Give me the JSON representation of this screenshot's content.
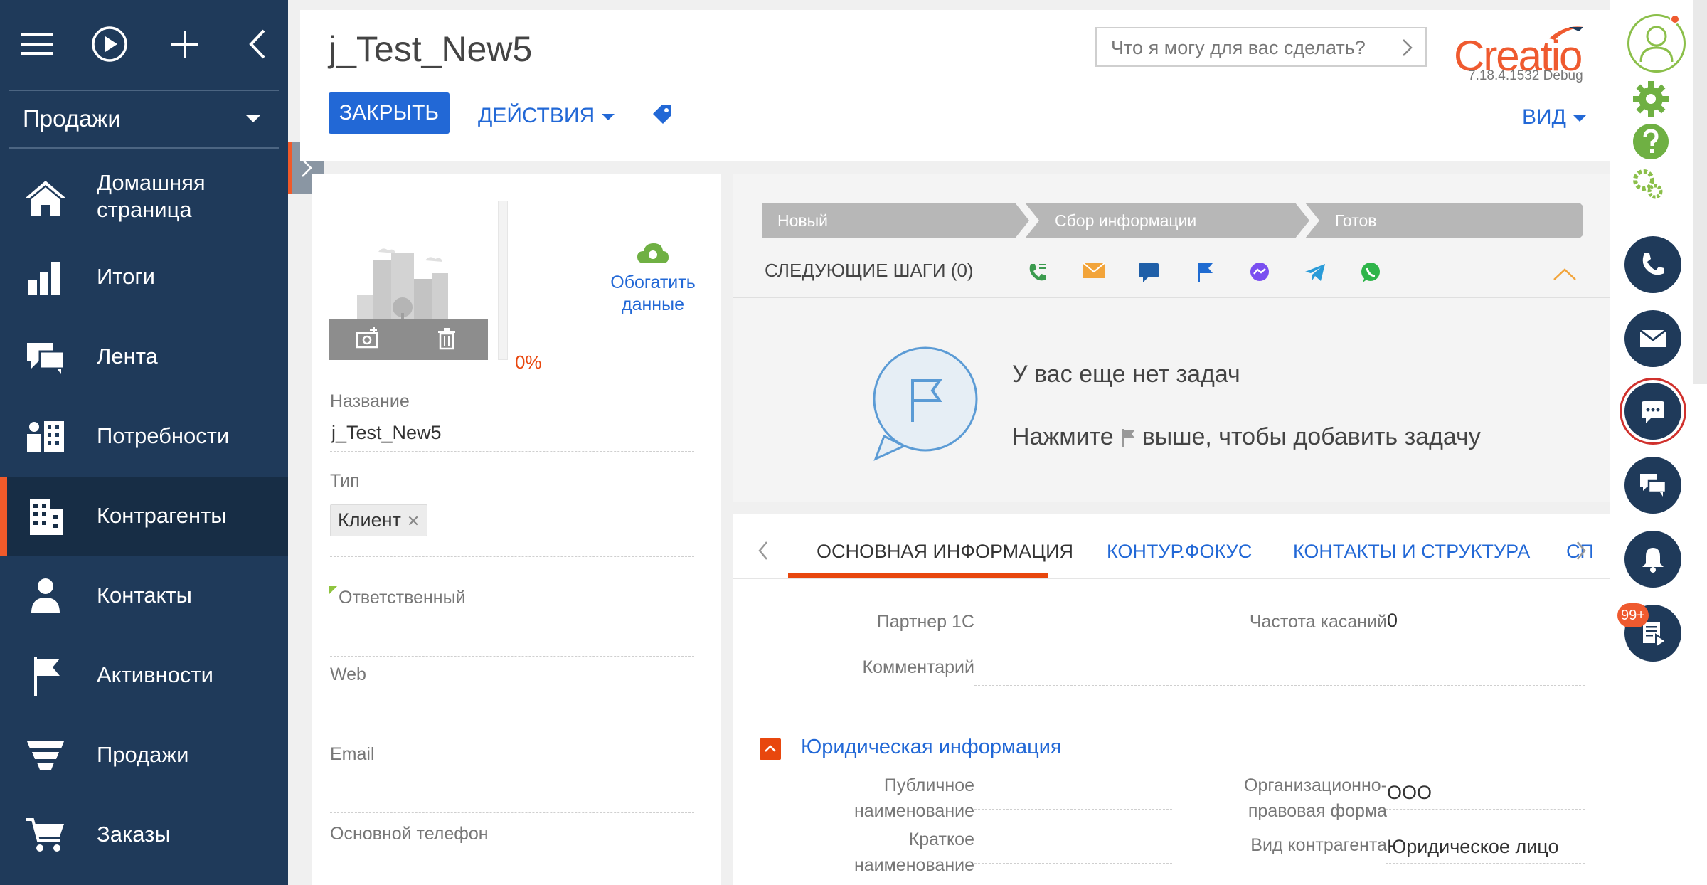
{
  "colors": {
    "sidebar_bg": "#1f3a5a",
    "accent_blue": "#2268d6",
    "accent_orange": "#e8470e",
    "stage_gray": "#b7b7b7"
  },
  "sidebar": {
    "top_icons": [
      "menu-icon",
      "play-icon",
      "plus-icon",
      "chevron-left-icon"
    ],
    "section": "Продажи",
    "items": [
      {
        "label": "Домашняя\nстраница",
        "icon": "home-icon"
      },
      {
        "label": "Итоги",
        "icon": "bar-chart-icon"
      },
      {
        "label": "Лента",
        "icon": "feed-icon"
      },
      {
        "label": "Потребности",
        "icon": "needs-icon"
      },
      {
        "label": "Контрагенты",
        "icon": "building-icon",
        "active": true
      },
      {
        "label": "Контакты",
        "icon": "person-icon"
      },
      {
        "label": "Активности",
        "icon": "flag-icon"
      },
      {
        "label": "Продажи",
        "icon": "funnel-icon"
      },
      {
        "label": "Заказы",
        "icon": "cart-icon"
      }
    ]
  },
  "header": {
    "title": "j_Test_New5",
    "close_button": "ЗАКРЫТЬ",
    "actions_button": "ДЕЙСТВИЯ",
    "view_button": "ВИД",
    "search_placeholder": "Что я могу для вас сделать?",
    "logo_text": "Creatio",
    "version": "7.18.4.1532 Debug"
  },
  "profile": {
    "completeness": "0%",
    "enrich_label_1": "Обогатить",
    "enrich_label_2": "данные",
    "fields": {
      "name_label": "Название",
      "name_value": "j_Test_New5",
      "type_label": "Тип",
      "type_chip": "Клиент",
      "owner_label": "Ответственный",
      "web_label": "Web",
      "email_label": "Email",
      "phone_label": "Основной телефон"
    }
  },
  "dashboard": {
    "stages": [
      "Новый",
      "Сбор информации",
      "Готов"
    ],
    "next_steps": "СЛЕДУЮЩИЕ ШАГИ (0)",
    "channel_icons": [
      "call-icon",
      "email-icon",
      "chat-icon",
      "flag-icon",
      "messenger-icon",
      "telegram-icon",
      "whatsapp-icon"
    ],
    "empty_title": "У вас еще нет задач",
    "empty_hint_before": "Нажмите",
    "empty_hint_after": "выше, чтобы добавить задачу"
  },
  "tabs": {
    "items": [
      "ОСНОВНАЯ ИНФОРМАЦИЯ",
      "КОНТУР.ФОКУС",
      "КОНТАКТЫ И СТРУКТУРА",
      "СПЕ"
    ],
    "active_index": 0
  },
  "main_form": {
    "partner_label": "Партнер 1С",
    "partner_value": "",
    "frequency_label": "Частота касаний",
    "frequency_value": "0",
    "comment_label": "Комментарий",
    "comment_value": "",
    "legal_group": "Юридическая информация",
    "public_name_label_1": "Публичное",
    "public_name_label_2": "наименование",
    "public_name_value": "",
    "org_form_label_1": "Организационно-",
    "org_form_label_2": "правовая форма",
    "org_form_value": "ООО",
    "short_name_label_1": "Краткое",
    "short_name_label_2": "наименование",
    "short_name_value": "",
    "account_kind_label": "Вид контрагента",
    "account_kind_value": "Юридическое лицо"
  },
  "right_rail": {
    "icons": [
      "avatar-icon",
      "settings-gear-icon",
      "help-icon",
      "system-settings-icon",
      "phone-icon",
      "mail-icon",
      "chat-icon",
      "feed-icon",
      "bell-icon",
      "tasks-icon"
    ],
    "badge": "99+"
  }
}
